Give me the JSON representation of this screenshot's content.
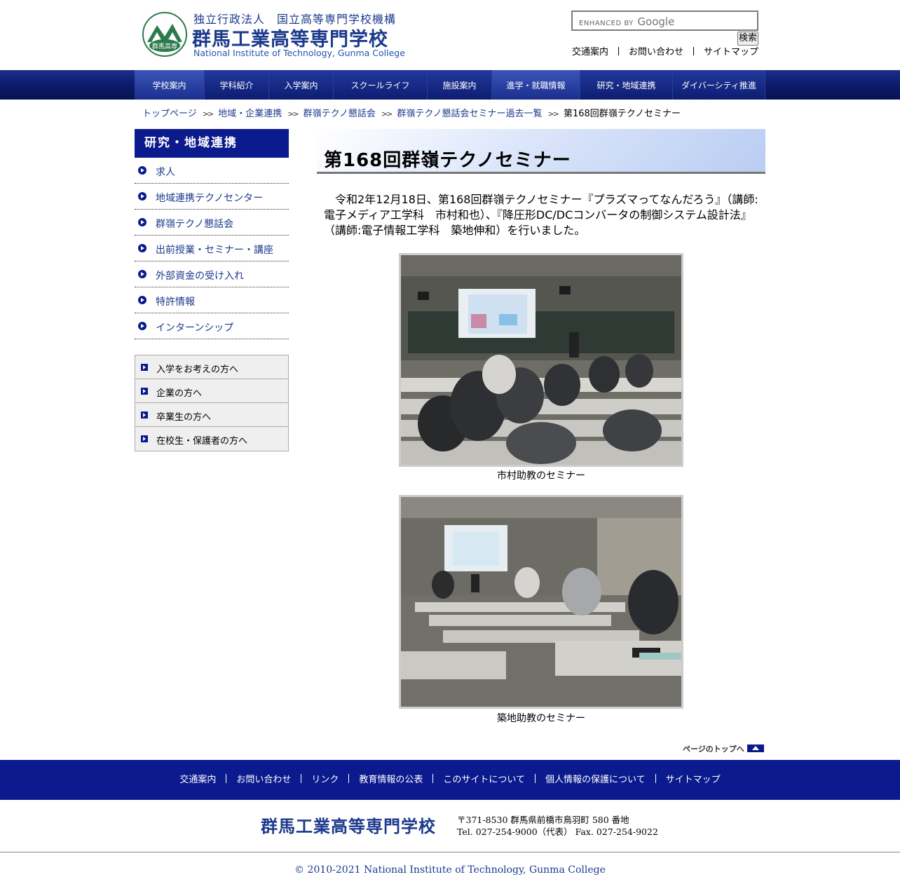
{
  "header": {
    "logo_org": "独立行政法人　国立高等専門学校機構",
    "logo_school": "群馬工業高等専門学校",
    "logo_en": "National Institute of Technology, Gunma College",
    "logo_emblem_text": "群馬高専",
    "search_placeholder": "ENHANCED BY",
    "search_google": "Google",
    "search_button": "検索",
    "links": [
      "交通案内",
      "お問い合わせ",
      "サイトマップ"
    ]
  },
  "gnav": [
    {
      "label": "学校案内",
      "width": 100
    },
    {
      "label": "学科紹介",
      "width": 92
    },
    {
      "label": "入学案内",
      "width": 92
    },
    {
      "label": "スクールライフ",
      "width": 134
    },
    {
      "label": "施設案内",
      "width": 92
    },
    {
      "label": "進学・就職情報",
      "width": 126
    },
    {
      "label": "研究・地域連携",
      "width": 132
    },
    {
      "label": "ダイバーシティ推進",
      "width": 132
    }
  ],
  "breadcrumb": [
    "トップページ",
    "地域・企業連携",
    "群嶺テクノ懇話会",
    "群嶺テクノ懇話会セミナー過去一覧",
    "第168回群嶺テクノセミナー"
  ],
  "sidebar": {
    "title": "研究・地域連携",
    "items": [
      "求人",
      "地域連携テクノセンター",
      "群嶺テクノ懇話会",
      "出前授業・セミナー・講座",
      "外部資金の受け入れ",
      "特許情報",
      "インターンシップ"
    ]
  },
  "audience": [
    "入学をお考えの方へ",
    "企業の方へ",
    "卒業生の方へ",
    "在校生・保護者の方へ"
  ],
  "main": {
    "title": "第168回群嶺テクノセミナー",
    "intro": "令和2年12月18日、第168回群嶺テクノセミナー『プラズマってなんだろう』（講師:電子メディア工学科　市村和也）、『降圧形DC/DCコンバータの制御システム設計法』（講師:電子情報工学科　築地伸和）を行いました。",
    "caption1": "市村助教のセミナー",
    "caption2": "築地助教のセミナー",
    "pagetop": "ページのトップへ"
  },
  "footer": {
    "links": [
      "交通案内",
      "お問い合わせ",
      "リンク",
      "教育情報の公表",
      "このサイトについて",
      "個人情報の保護について",
      "サイトマップ"
    ],
    "school": "群馬工業高等専門学校",
    "address": "〒371-8530 群馬県前橋市鳥羽町 580 番地",
    "tel": "Tel. 027-254-9000（代表） Fax. 027-254-9022",
    "copyright": "© 2010-2021 National Institute of Technology, Gunma College"
  },
  "colors": {
    "navy": "#0b1a8c",
    "link": "#1c3a8c"
  }
}
